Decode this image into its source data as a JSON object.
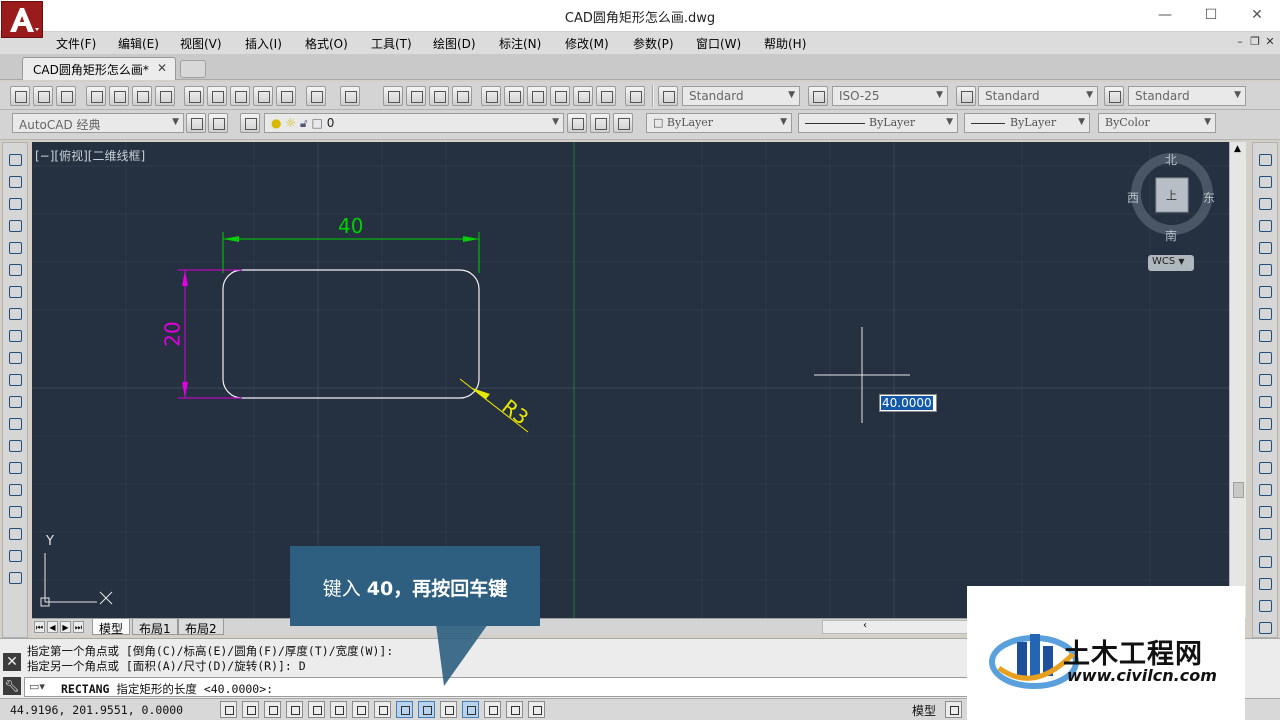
{
  "window": {
    "title": "CAD圆角矩形怎么画.dwg",
    "minimize": "—",
    "maximize": "☐",
    "close": "✕"
  },
  "menu": [
    "文件(F)",
    "编辑(E)",
    "视图(V)",
    "插入(I)",
    "格式(O)",
    "工具(T)",
    "绘图(D)",
    "标注(N)",
    "修改(M)",
    "参数(P)",
    "窗口(W)",
    "帮助(H)"
  ],
  "document_tab": {
    "label": "CAD圆角矩形怎么画*",
    "close": "✕"
  },
  "styles_toolbar": {
    "text_style": "Standard",
    "dim_style": "ISO-25",
    "table_style": "Standard",
    "multileader_style": "Standard"
  },
  "layers_toolbar": {
    "workspace": "AutoCAD 经典",
    "layer": "0",
    "color": "ByLayer",
    "linetype": "ByLayer",
    "lineweight": "ByLayer",
    "plot_style": "ByColor"
  },
  "viewport": {
    "label": "[−][俯视][二维线框]"
  },
  "drawing": {
    "width_dim": "40",
    "height_dim": "20",
    "radius_dim": "R3",
    "dynamic_input": "40.0000"
  },
  "navcube": {
    "north": "北",
    "south": "南",
    "east": "东",
    "west": "西",
    "top_face": "上",
    "wcs": "WCS"
  },
  "ucs": {
    "x": "X",
    "y": "Y"
  },
  "layout_tabs": [
    "模型",
    "布局1",
    "布局2"
  ],
  "command": {
    "history": [
      "指定第一个角点或 [倒角(C)/标高(E)/圆角(F)/厚度(T)/宽度(W)]:",
      "指定另一个角点或 [面积(A)/尺寸(D)/旋转(R)]: D"
    ],
    "prompt_cmd": "RECTANG",
    "prompt_text": "指定矩形的长度 <40.0000>:"
  },
  "status": {
    "coords": "44.9196,  201.9551, 0.0000",
    "model": "模型"
  },
  "callout": {
    "prefix": "键入 ",
    "value": "40",
    "suffix": "，再按回车键"
  },
  "watermark": {
    "title": "土木工程网",
    "url": "www.civilcn.com"
  },
  "colors": {
    "canvas_bg": "#253040",
    "dimension_green": "#00d000",
    "dimension_magenta": "#e000e0",
    "dimension_yellow": "#e8e800",
    "callout_bg": "#2e5f80",
    "logo_red": "#9a1b1b"
  }
}
